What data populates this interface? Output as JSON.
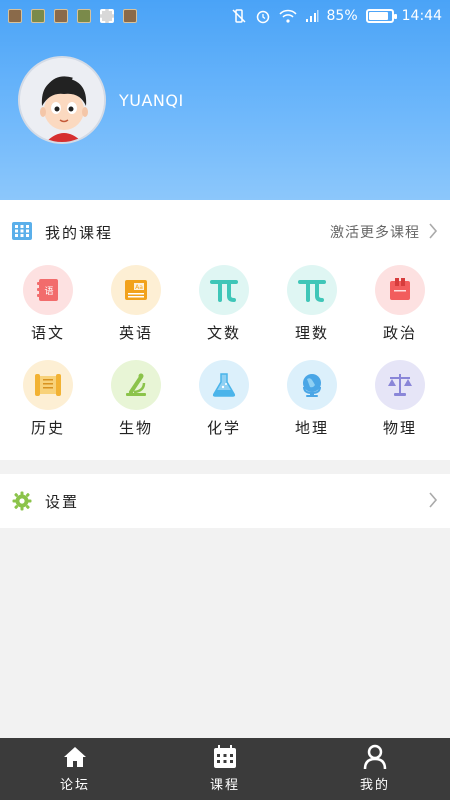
{
  "status_bar": {
    "battery": "85%",
    "time": "14:44",
    "battery_level": 0.85
  },
  "profile": {
    "username": "YUANQI"
  },
  "courses": {
    "title": "我的课程",
    "activate_more": "激活更多课程",
    "subjects": [
      {
        "label": "语文",
        "icon": "book-icon",
        "color": "#f26c6c",
        "bg": "#fde1e1"
      },
      {
        "label": "英语",
        "icon": "english-book-icon",
        "color": "#f2a21b",
        "bg": "#fdefd4"
      },
      {
        "label": "文数",
        "icon": "pi-icon",
        "color": "#3fc6b8",
        "bg": "#dff6f3"
      },
      {
        "label": "理数",
        "icon": "pi-icon",
        "color": "#3fc6b8",
        "bg": "#dff6f3"
      },
      {
        "label": "政治",
        "icon": "notebook-icon",
        "color": "#f25d5d",
        "bg": "#fde1e1"
      },
      {
        "label": "历史",
        "icon": "scroll-icon",
        "color": "#f2b233",
        "bg": "#fdefd4"
      },
      {
        "label": "生物",
        "icon": "microscope-icon",
        "color": "#8bc34a",
        "bg": "#e8f5d6"
      },
      {
        "label": "化学",
        "icon": "flask-icon",
        "color": "#4ab4ea",
        "bg": "#dcf0fb"
      },
      {
        "label": "地理",
        "icon": "globe-icon",
        "color": "#4aa6e6",
        "bg": "#dcf0fb"
      },
      {
        "label": "物理",
        "icon": "scale-icon",
        "color": "#8a86d8",
        "bg": "#e6e5f7"
      }
    ]
  },
  "settings": {
    "label": "设置"
  },
  "bottom_nav": {
    "items": [
      {
        "label": "论坛",
        "icon": "home-icon"
      },
      {
        "label": "课程",
        "icon": "calendar-icon"
      },
      {
        "label": "我的",
        "icon": "person-icon"
      }
    ]
  },
  "colors": {
    "accent_blue": "#4aa3f7",
    "settings_green": "#8bc34a",
    "nav_bg": "#3b3b3b"
  }
}
